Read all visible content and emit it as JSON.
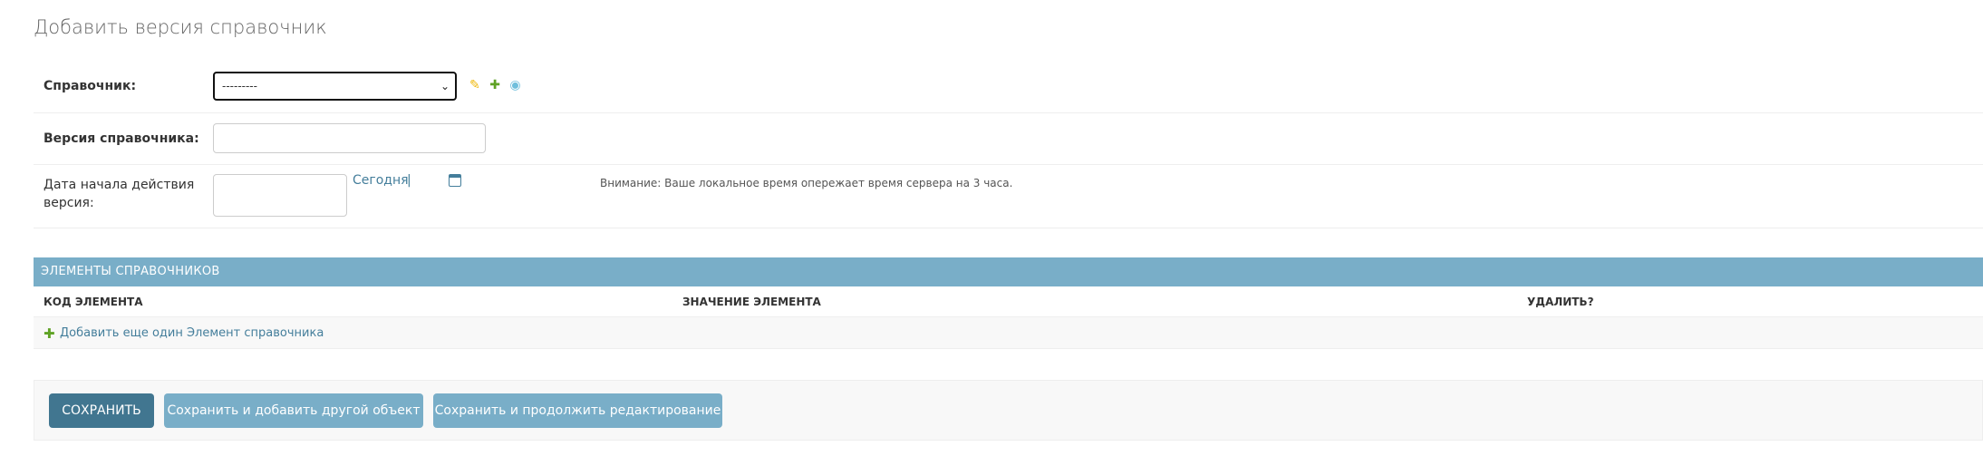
{
  "page": {
    "title": "Добавить версия справочник"
  },
  "fields": {
    "directory": {
      "label": "Справочник:",
      "selected": "---------"
    },
    "version": {
      "label": "Версия справочника:",
      "value": ""
    },
    "start_date": {
      "label_line1": "Дата начала действия",
      "label_line2": "версия:",
      "value": "",
      "today_link": "Сегодня",
      "separator": "|",
      "warning": "Внимание: Ваше локальное время опережает время сервера на 3 часа."
    }
  },
  "inline": {
    "header": "ЭЛЕМЕНТЫ СПРАВОЧНИКОВ",
    "columns": [
      "КОД ЭЛЕМЕНТА",
      "ЗНАЧЕНИЕ ЭЛЕМЕНТА",
      "УДАЛИТЬ?"
    ],
    "add_link": "Добавить еще один Элемент справочника"
  },
  "buttons": {
    "save": "СОХРАНИТЬ",
    "save_add": "Сохранить и добавить другой объект",
    "save_continue": "Сохранить и продолжить редактирование"
  },
  "icons": {
    "edit": "pencil-icon",
    "add": "plus-icon",
    "view": "eye-icon",
    "calendar": "calendar-icon"
  },
  "colors": {
    "inline_header": "#79aec8",
    "primary_button": "#417690",
    "secondary_button": "#79aec8",
    "link": "#447e9b"
  }
}
